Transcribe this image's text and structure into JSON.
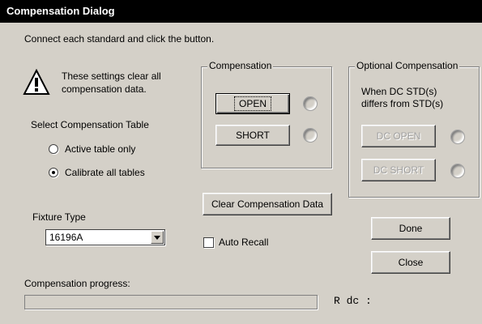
{
  "window": {
    "title": "Compensation Dialog"
  },
  "instruction": "Connect each standard and click the button.",
  "warning": {
    "icon": "warning-icon",
    "line1": "These settings clear all",
    "line2": "compensation data."
  },
  "table_select": {
    "label": "Select Compensation Table",
    "options": [
      {
        "label": "Active table only",
        "selected": false
      },
      {
        "label": "Calibrate all tables",
        "selected": true
      }
    ]
  },
  "fixture": {
    "label": "Fixture Type",
    "value": "16196A"
  },
  "compensation": {
    "group_label": "Compensation",
    "open_label": "OPEN",
    "short_label": "SHORT"
  },
  "optional": {
    "group_label": "Optional Compensation",
    "note_line1": "When DC STD(s)",
    "note_line2": "differs from STD(s)",
    "dc_open_label": "DC OPEN",
    "dc_short_label": "DC SHORT"
  },
  "clear_button_label": "Clear Compensation Data",
  "auto_recall": {
    "label": "Auto Recall",
    "checked": false
  },
  "done_label": "Done",
  "close_label": "Close",
  "progress": {
    "label": "Compensation progress:",
    "value": 0
  },
  "rdc_label": "R dc :"
}
